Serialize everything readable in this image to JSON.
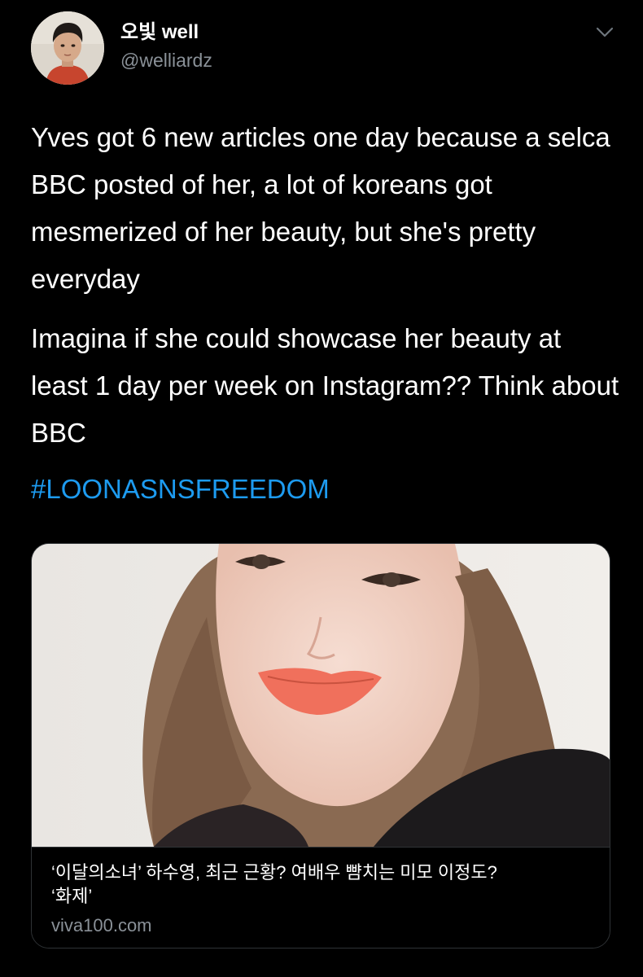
{
  "author": {
    "display_name": "오빛 well",
    "handle": "@welliardz",
    "avatar_icon": "profile-photo-avatar"
  },
  "tweet": {
    "paragraph_1": "Yves got 6 new articles one day because a selca BBC posted of her, a lot of koreans got mesmerized of her beauty, but she's pretty everyday",
    "paragraph_2": "Imagina if she could showcase her beauty at least 1 day per week on Instagram?? Think about BBC",
    "hashtag": "#LOONASNSFREEDOM"
  },
  "link_card": {
    "title_line_1": "‘이달의소녀’ 하수영, 최근 근황? 여배우 뺨치는 미모 이정도?",
    "title_line_2": "‘화제’",
    "domain": "viva100.com",
    "image_icon": "selfie-photo"
  },
  "menu": {
    "icon": "chevron-down-icon"
  },
  "colors": {
    "background": "#000000",
    "text": "#ffffff",
    "secondary_text": "#8a9198",
    "link": "#1d9bf0",
    "border": "#2f3336"
  }
}
